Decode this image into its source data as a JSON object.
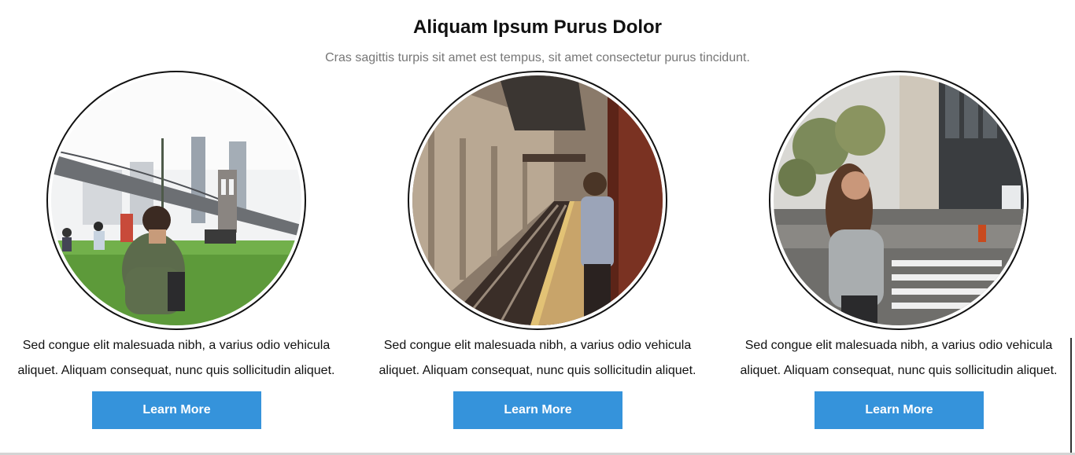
{
  "section": {
    "title": "Aliquam Ipsum Purus Dolor",
    "subtitle": "Cras sagittis turpis sit amet est tempus, sit amet consectetur purus tincidunt."
  },
  "cards": [
    {
      "text": "Sed congue elit malesuada nibh, a varius odio vehicula aliquet. Aliquam consequat, nunc quis sollicitudin aliquet.",
      "button_label": "Learn More"
    },
    {
      "text": "Sed congue elit malesuada nibh, a varius odio vehicula aliquet. Aliquam consequat, nunc quis sollicitudin aliquet.",
      "button_label": "Learn More"
    },
    {
      "text": "Sed congue elit malesuada nibh, a varius odio vehicula aliquet. Aliquam consequat, nunc quis sollicitudin aliquet.",
      "button_label": "Learn More"
    }
  ],
  "colors": {
    "button_bg": "#3593db",
    "title": "#111111",
    "subtitle": "#777777"
  }
}
